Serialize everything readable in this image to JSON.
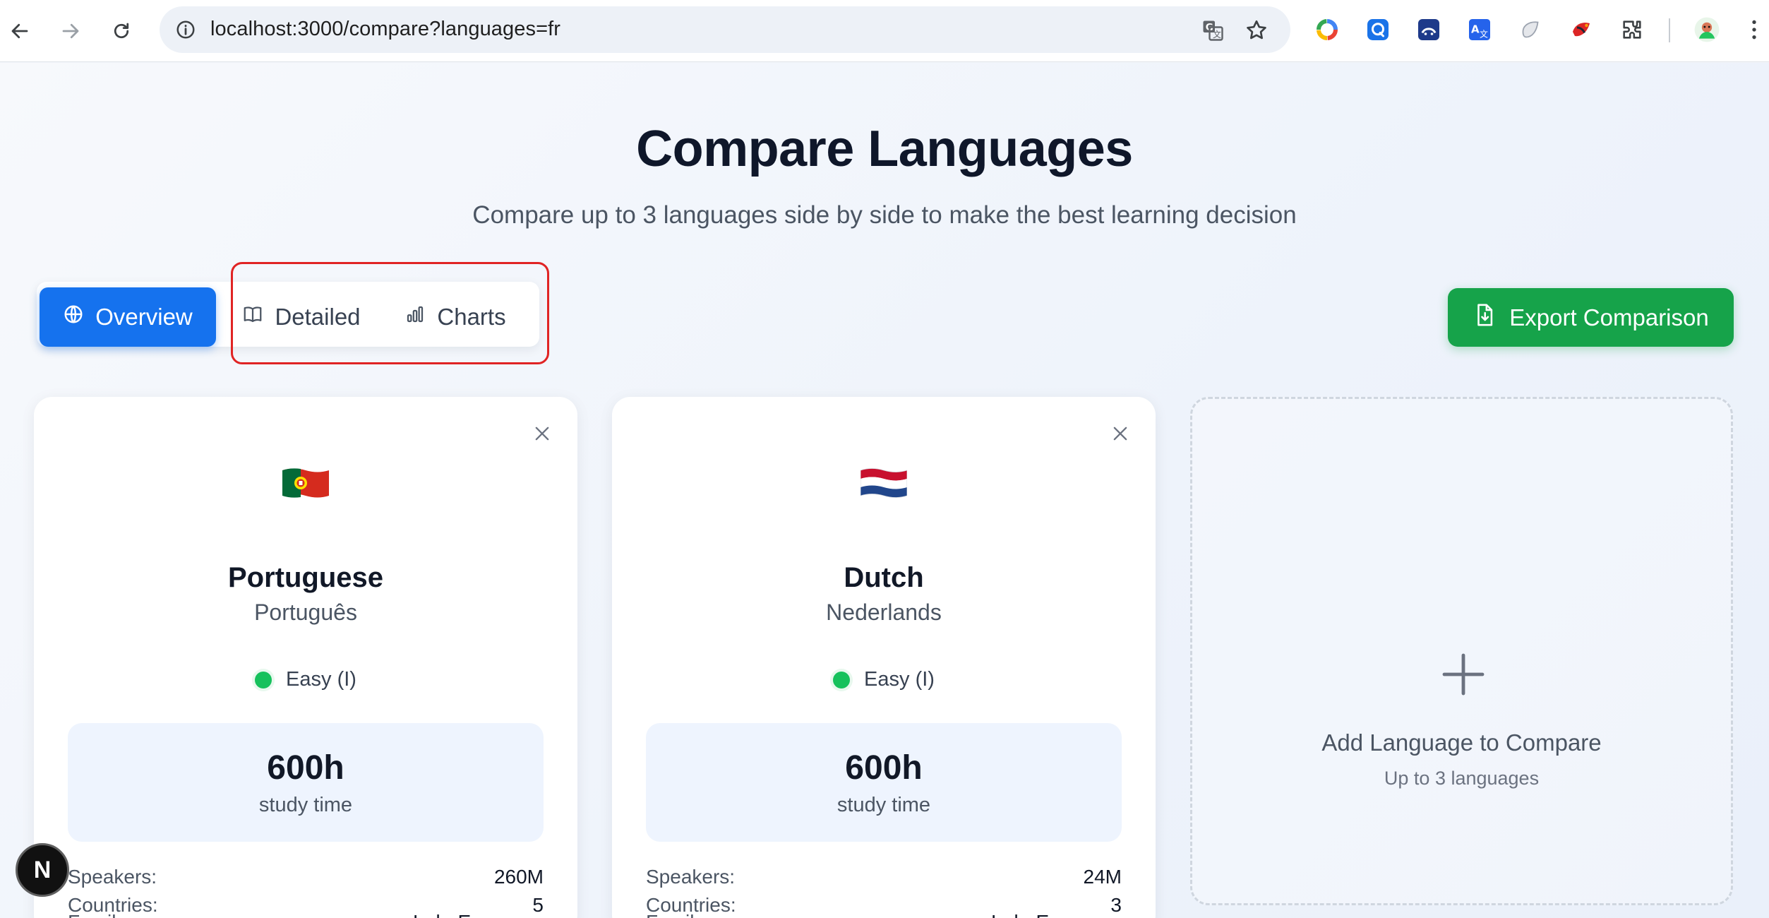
{
  "browser": {
    "url": "localhost:3000/compare?languages=fr",
    "icons": [
      "back-icon",
      "forward-icon",
      "reload-icon",
      "site-info-icon",
      "translate-icon",
      "bookmark-star-icon",
      "extensions-icon",
      "profile-avatar"
    ]
  },
  "page": {
    "title": "Compare Languages",
    "subtitle": "Compare up to 3 languages side by side to make the best learning decision"
  },
  "tabs": [
    {
      "label": "Overview",
      "icon": "globe-icon",
      "active": true
    },
    {
      "label": "Detailed",
      "icon": "book-icon",
      "active": false
    },
    {
      "label": "Charts",
      "icon": "bar-chart-icon",
      "active": false
    }
  ],
  "export": {
    "label": "Export Comparison",
    "icon": "file-download-icon"
  },
  "cards": [
    {
      "flag": "portugal-flag",
      "name": "Portuguese",
      "native": "Português",
      "difficulty": "Easy (I)",
      "hours": "600h",
      "hours_label": "study time",
      "stats": [
        {
          "label": "Speakers:",
          "value": "260M"
        },
        {
          "label": "Family:",
          "value": "Indo-European"
        },
        {
          "label": "Countries:",
          "value": "5"
        }
      ]
    },
    {
      "flag": "netherlands-flag",
      "name": "Dutch",
      "native": "Nederlands",
      "difficulty": "Easy (I)",
      "hours": "600h",
      "hours_label": "study time",
      "stats": [
        {
          "label": "Speakers:",
          "value": "24M"
        },
        {
          "label": "Family:",
          "value": "Indo-European"
        },
        {
          "label": "Countries:",
          "value": "3"
        }
      ]
    }
  ],
  "add_card": {
    "title": "Add Language to Compare",
    "subtitle": "Up to 3 languages"
  },
  "badge": {
    "letter": "N"
  },
  "colors": {
    "accent": "#1572ee",
    "export": "#16a34a",
    "easy": "#16c15c",
    "highlight": "#e02424"
  }
}
